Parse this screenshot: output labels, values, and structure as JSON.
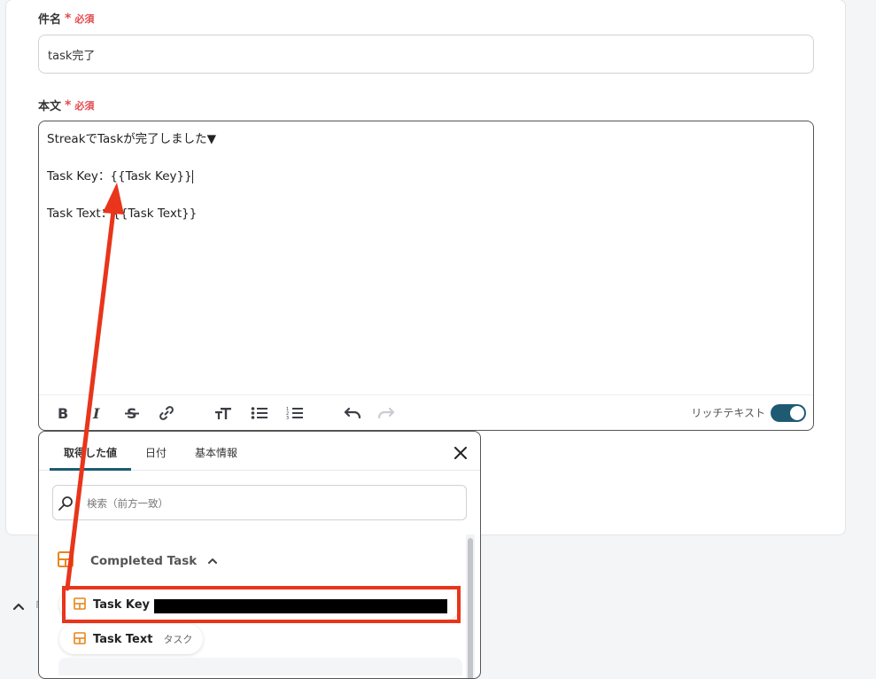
{
  "subject": {
    "label": "件名",
    "required_mark": "*",
    "required_text": "必須",
    "value": "task完了"
  },
  "body": {
    "label": "本文",
    "required_mark": "*",
    "required_text": "必須",
    "lines": [
      "StreakでTaskが完了しました▼",
      "",
      "Task Key：{{Task Key}}",
      "",
      "Task Text：{{Task Text}}"
    ],
    "rich_text_label": "リッチテキスト",
    "rich_text_enabled": true
  },
  "toolbar": {
    "icons": [
      "bold-icon",
      "italic-icon",
      "strikethrough-icon",
      "link-icon",
      "text-size-icon",
      "bullet-list-icon",
      "numbered-list-icon",
      "undo-icon",
      "redo-icon"
    ]
  },
  "popup": {
    "tabs": [
      "取得した値",
      "日付",
      "基本情報"
    ],
    "active_tab": 0,
    "search_placeholder": "検索（前方一致）",
    "group": {
      "label": "Completed Task",
      "items": [
        {
          "label": "Task Key",
          "sub": ""
        },
        {
          "label": "Task Text",
          "sub": "タスク"
        }
      ]
    }
  },
  "outside": {
    "partial_text": "⊓"
  },
  "colors": {
    "accent": "#1e5b73",
    "required": "#e5484d",
    "annotation": "#e8351b",
    "item_icon": "#e8861b"
  }
}
